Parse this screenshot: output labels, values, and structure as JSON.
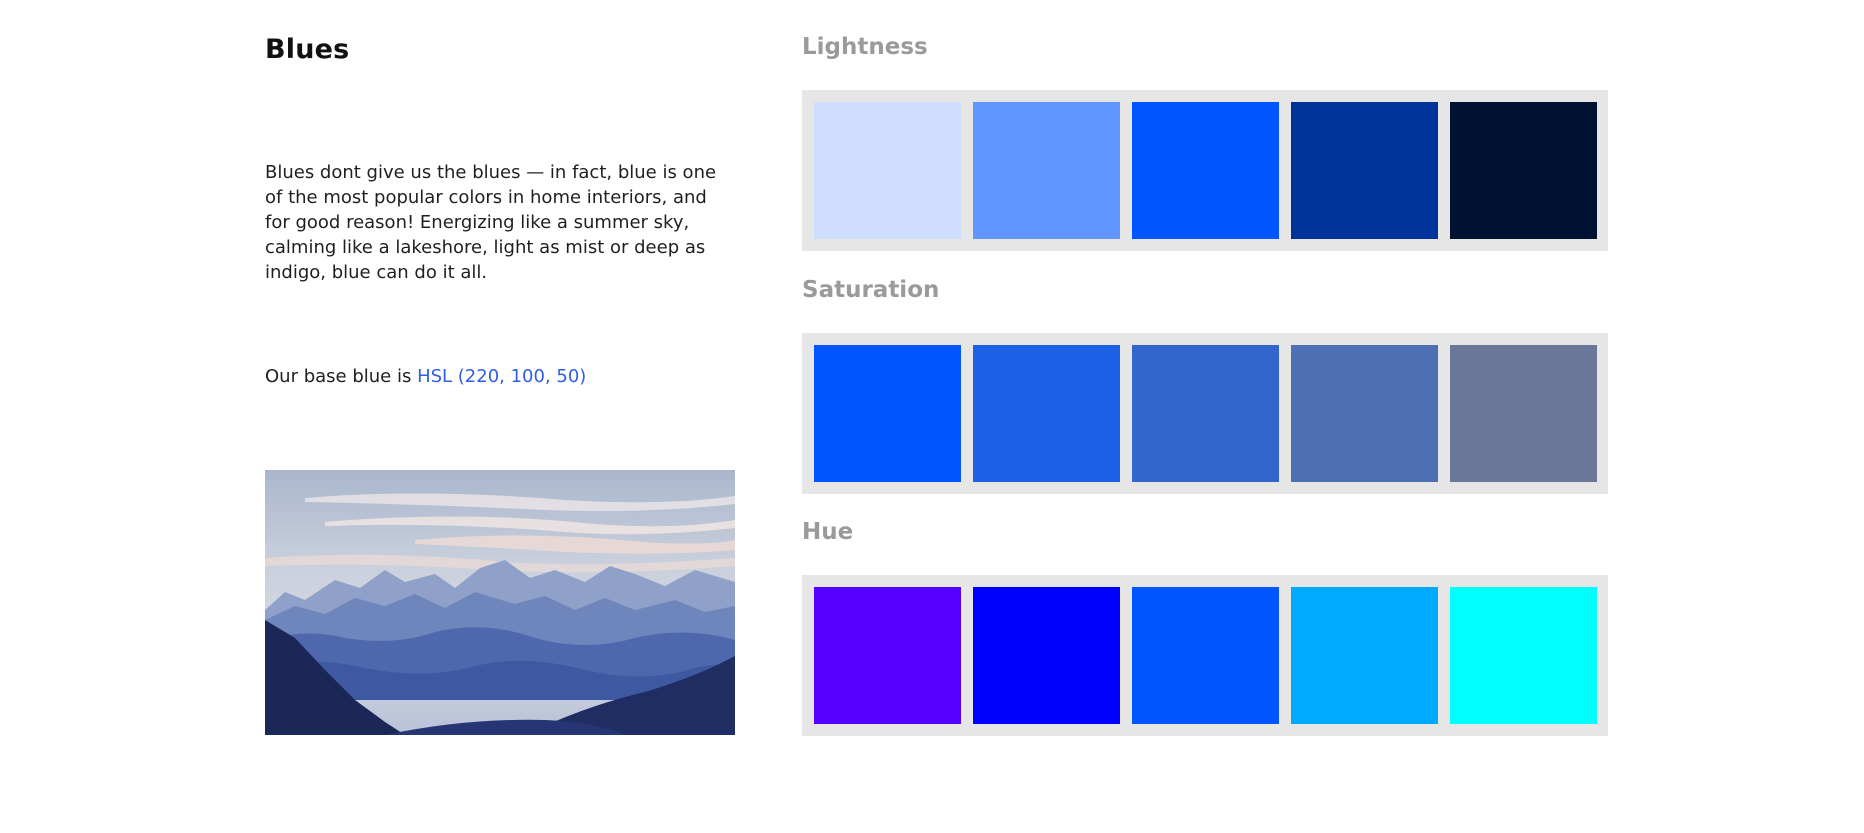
{
  "intro": {
    "title": "Blues",
    "description": "Blues dont give us the blues — in fact, blue is one of the most popular colors in home interiors, and for good reason! Energizing like a summer sky, calming like a lakeshore, light as mist or deep as indigo, blue can do it all.",
    "base_prefix": "Our base blue is ",
    "base_link": "HSL (220, 100, 50)",
    "image": "mountain-landscape"
  },
  "palettes": [
    {
      "title": "Lightness",
      "swatches": [
        "#cfdeff",
        "#6296ff",
        "#0055ff",
        "#00339a",
        "#001232"
      ]
    },
    {
      "title": "Saturation",
      "swatches": [
        "#0055ff",
        "#1b60e5",
        "#3366cc",
        "#4c70b3",
        "#6a7799"
      ]
    },
    {
      "title": "Hue",
      "swatches": [
        "#5500ff",
        "#0000ff",
        "#0055ff",
        "#00aaff",
        "#00ffff"
      ]
    }
  ]
}
